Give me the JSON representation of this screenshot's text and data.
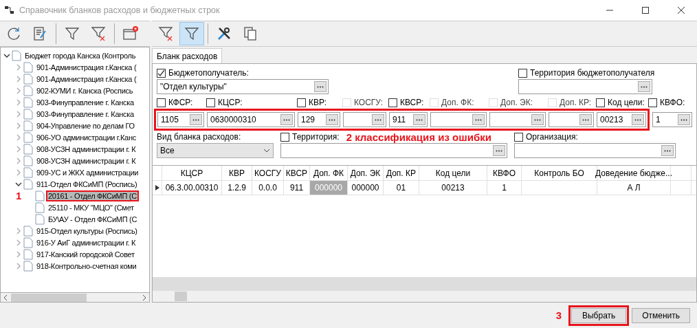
{
  "window": {
    "title": "Справочник бланков расходов и бюджетных строк"
  },
  "left_toolbar": [
    {
      "kind": "refresh",
      "selected": false
    },
    {
      "kind": "edit",
      "selected": false
    },
    {
      "kind": "separator",
      "selected": false
    },
    {
      "kind": "filter",
      "selected": false
    },
    {
      "kind": "filter-clear",
      "selected": false
    },
    {
      "kind": "separator",
      "selected": false
    },
    {
      "kind": "close-window",
      "selected": false
    }
  ],
  "right_toolbar": [
    {
      "kind": "filter-clear",
      "selected": false
    },
    {
      "kind": "filter",
      "selected": true
    },
    {
      "kind": "separator",
      "selected": false
    },
    {
      "kind": "tools",
      "selected": false
    },
    {
      "kind": "copy",
      "selected": false
    }
  ],
  "tree": [
    {
      "label": "Бюджет города Канска (Контроль",
      "expanded": true,
      "selected": false,
      "children": [
        {
          "label": "901-Администрация г.Канска (",
          "expanded": false,
          "selected": false
        },
        {
          "label": "901-Администрация г.Канска (",
          "expanded": false,
          "selected": false
        },
        {
          "label": "902-КУМИ г. Канска (Роспись",
          "expanded": false,
          "selected": false
        },
        {
          "label": "903-Финуправление г. Канска",
          "expanded": false,
          "selected": false
        },
        {
          "label": "903-Финуправление г. Канска",
          "expanded": false,
          "selected": false
        },
        {
          "label": "904-Управление по делам ГО",
          "expanded": false,
          "selected": false
        },
        {
          "label": "906-УО администрации г.Канс",
          "expanded": false,
          "selected": false
        },
        {
          "label": "908-УСЗН администрации г. К",
          "expanded": false,
          "selected": false
        },
        {
          "label": "908-УСЗН администрации г. К",
          "expanded": false,
          "selected": false
        },
        {
          "label": "909-УС и ЖКХ администрации",
          "expanded": false,
          "selected": false
        },
        {
          "label": "911-Отдел ФКСиМП (Роспись)",
          "expanded": true,
          "selected": false,
          "children": [
            {
              "label": "20161 - Отдел ФКСиМП (С",
              "selected": true,
              "annotation": "1"
            },
            {
              "label": "25110 - МКУ \"МЦО\" (Смет",
              "selected": false
            },
            {
              "label": "БУ\\АУ - Отдел ФКСиМП (С",
              "selected": false
            }
          ]
        },
        {
          "label": "915-Отдел культуры (Роспись)",
          "expanded": false,
          "selected": false
        },
        {
          "label": "916-У АиГ администрации г. К",
          "expanded": false,
          "selected": false
        },
        {
          "label": "917-Канский городской Совет",
          "expanded": false,
          "selected": false
        },
        {
          "label": "918-Контрольно-счетная коми",
          "expanded": false,
          "selected": false
        }
      ]
    }
  ],
  "tabs": [
    {
      "label": "Бланк расходов",
      "selected": true
    }
  ],
  "recipient": {
    "label": "Бюджетополучатель:",
    "checked": true,
    "value": "\"Отдел культуры\""
  },
  "recipient_territory": {
    "label": "Территория бюджетополучателя",
    "checked": false
  },
  "classifiers": [
    {
      "label": "КФСР:",
      "checked": false,
      "disabled": false,
      "value": "1105"
    },
    {
      "label": "КЦСР:",
      "checked": false,
      "disabled": false,
      "value": "0630000310"
    },
    {
      "label": "КВР:",
      "checked": false,
      "disabled": false,
      "value": "129"
    },
    {
      "label": "КОСГУ:",
      "checked": false,
      "disabled": true
    },
    {
      "label": "КВСР:",
      "checked": false,
      "disabled": false,
      "value": "911"
    },
    {
      "label": "Доп. ФК:",
      "checked": false,
      "disabled": true
    },
    {
      "label": "Доп. ЭК:",
      "checked": false,
      "disabled": true
    },
    {
      "label": "Доп. КР:",
      "checked": false,
      "disabled": true
    },
    {
      "label": "Код цели:",
      "checked": false,
      "disabled": false,
      "value": "00213"
    },
    {
      "label": "КВФО:",
      "checked": false,
      "disabled": false,
      "value": "1"
    }
  ],
  "classifiers_annotation": "2 классификация из ошибки",
  "form_type": {
    "label": "Вид бланка расходов:",
    "value": "Все"
  },
  "territory": {
    "label": "Территория:",
    "checked": false
  },
  "organization": {
    "label": "Организация:",
    "checked": false
  },
  "grid": {
    "columns": [
      "КЦСР",
      "КВР",
      "КОСГУ",
      "КВСР",
      "Доп. ФК",
      "Доп. ЭК",
      "Доп. КР",
      "Код цели",
      "КВФО",
      "Контроль БО",
      "Доведение бюдже..."
    ],
    "rows": [
      {
        "current": true,
        "cells": [
          {
            "text": "06.3.00.00310",
            "selected": false
          },
          {
            "text": "1.2.9",
            "selected": false
          },
          {
            "text": "0.0.0",
            "selected": false
          },
          {
            "text": "911",
            "selected": false
          },
          {
            "text": "000000",
            "selected": true
          },
          {
            "text": "000000",
            "selected": false
          },
          {
            "text": "01",
            "selected": false
          },
          {
            "text": "00213",
            "selected": false
          },
          {
            "text": "1",
            "selected": false
          },
          {
            "selected": false
          },
          {
            "text": "А Л",
            "selected": false
          }
        ]
      }
    ]
  },
  "buttons": [
    {
      "label": "Выбрать",
      "annotation": "3"
    },
    {
      "label": "Отменить"
    }
  ]
}
